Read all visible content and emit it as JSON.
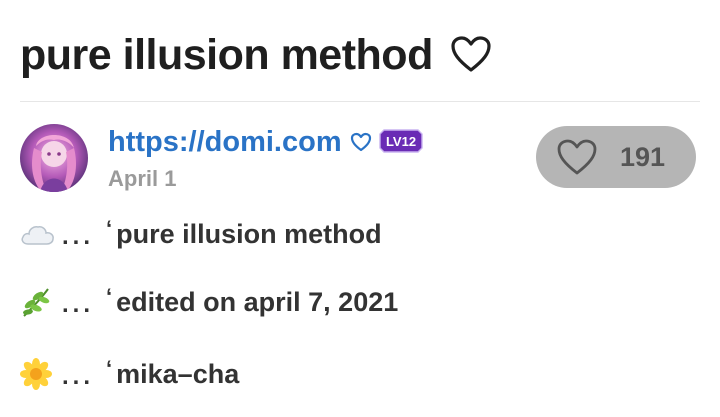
{
  "post": {
    "title": "pure illusion method"
  },
  "author": {
    "name": "https://domi.com",
    "level_label": "LV12",
    "date": "April 1"
  },
  "likes": {
    "count": "191"
  },
  "content": {
    "lines": [
      {
        "icon": "cloud-icon",
        "dots": "...",
        "quote": "‘",
        "text": "pure illusion method"
      },
      {
        "icon": "herb-icon",
        "dots": "...",
        "quote": "‘",
        "text": "edited on april 7, 2021"
      },
      {
        "icon": "blossom-icon",
        "dots": "...",
        "quote": "‘",
        "text": "mika–cha"
      }
    ]
  },
  "colors": {
    "link": "#2a73c6",
    "like_button_bg": "#b5b5b5",
    "level_badge": "#6a2bb5"
  }
}
